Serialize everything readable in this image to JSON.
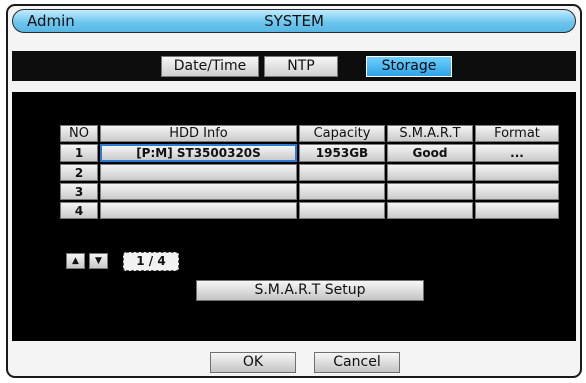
{
  "window": {
    "user": "Admin",
    "title": "SYSTEM"
  },
  "tabs": [
    {
      "label": "Date/Time",
      "active": false
    },
    {
      "label": "NTP",
      "active": false
    },
    {
      "label": "Storage",
      "active": true
    }
  ],
  "table": {
    "columns": [
      "NO",
      "HDD Info",
      "Capacity",
      "S.M.A.R.T",
      "Format"
    ],
    "rows": [
      {
        "no": "1",
        "hdd_info": "[P:M] ST3500320S",
        "capacity": "1953GB",
        "smart": "Good",
        "format": "..."
      },
      {
        "no": "2",
        "hdd_info": "",
        "capacity": "",
        "smart": "",
        "format": ""
      },
      {
        "no": "3",
        "hdd_info": "",
        "capacity": "",
        "smart": "",
        "format": ""
      },
      {
        "no": "4",
        "hdd_info": "",
        "capacity": "",
        "smart": "",
        "format": ""
      }
    ]
  },
  "pager": {
    "up_icon": "triangle-up",
    "down_icon": "triangle-down",
    "page": "1 / 4"
  },
  "buttons": {
    "smart_setup": "S.M.A.R.T Setup",
    "ok": "OK",
    "cancel": "Cancel"
  },
  "colors": {
    "titlebar": "#6ec6ee",
    "active_tab": "#2ea2e6",
    "content_bg": "#000000",
    "selection_border": "#2a7ad6"
  }
}
